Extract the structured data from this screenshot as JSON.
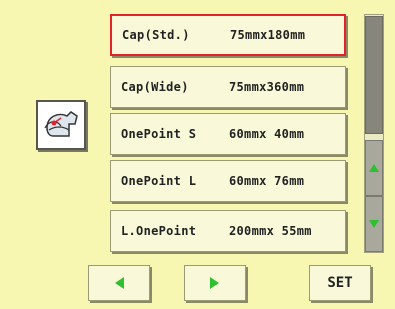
{
  "hoop_list": [
    {
      "name": "Cap(Std.)",
      "size": "75mmx180mm",
      "selected": true
    },
    {
      "name": "Cap(Wide)",
      "size": "75mmx360mm",
      "selected": false
    },
    {
      "name": "OnePoint S",
      "size": "60mmx 40mm",
      "selected": false
    },
    {
      "name": "OnePoint L",
      "size": "60mmx 76mm",
      "selected": false
    },
    {
      "name": "L.OnePoint",
      "size": "200mmx 55mm",
      "selected": false
    }
  ],
  "buttons": {
    "set_label": "SET"
  },
  "icons": {
    "cap_frame": "cap-frame-icon",
    "prev": "left-arrow-icon",
    "next": "right-arrow-icon",
    "scroll_up": "up-arrow-icon",
    "scroll_down": "down-arrow-icon"
  },
  "colors": {
    "background": "#f8f7b2",
    "selected_border": "#e2232c",
    "arrow_green": "#2fbf2f"
  }
}
